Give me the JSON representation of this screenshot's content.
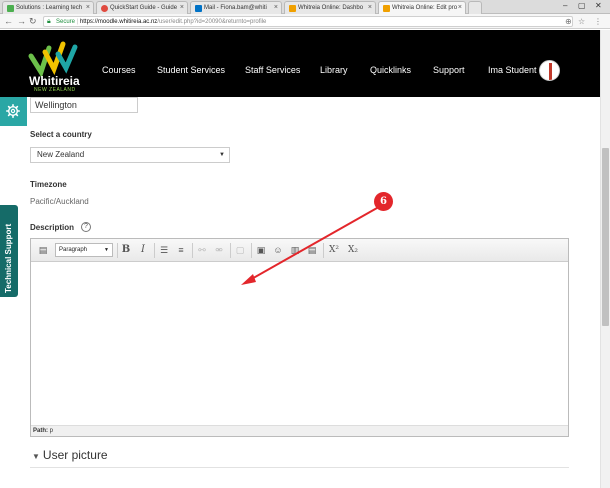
{
  "browser": {
    "tabs": [
      {
        "title": "Solutions : Learning tech",
        "favicon_color": "#4caf50",
        "active": false
      },
      {
        "title": "QuickStart Guide - Guide",
        "favicon_color": "#e04a3f",
        "active": false
      },
      {
        "title": "Mail - Fiona.bam@whiti",
        "favicon_color": "#0072c6",
        "active": false
      },
      {
        "title": "Whitreia Online: Dashbo",
        "favicon_color": "#f0a000",
        "active": false
      },
      {
        "title": "Whitreia Online: Edit pro",
        "favicon_color": "#f0a000",
        "active": true
      }
    ],
    "secure_label": "Secure",
    "url_host": "https://moodle.whitireia.ac.nz",
    "url_path": "/user/edit.php?id=20090&returnto=profile"
  },
  "header": {
    "logo_text": "Whitireia",
    "logo_sub": "NEW ZEALAND",
    "nav": [
      "Courses",
      "Student Services",
      "Staff Services",
      "Library",
      "Quicklinks",
      "Support"
    ],
    "user_name": "Ima Student"
  },
  "form": {
    "city_value": "Wellington",
    "country_label": "Select a country",
    "country_value": "New Zealand",
    "timezone_label": "Timezone",
    "timezone_value": "Pacific/Auckland",
    "description_label": "Description",
    "help_glyph": "?",
    "paragraph_format": "Paragraph",
    "status_path_label": "Path:",
    "status_path_value": "p",
    "section_user_picture": "User picture"
  },
  "side_tab": {
    "label": "Technical Support"
  },
  "annotation": {
    "number": "6",
    "color": "#e3262b"
  },
  "colors": {
    "accent_teal": "#2aa7a5",
    "side_tab": "#156b68",
    "header_bg": "#000000"
  }
}
